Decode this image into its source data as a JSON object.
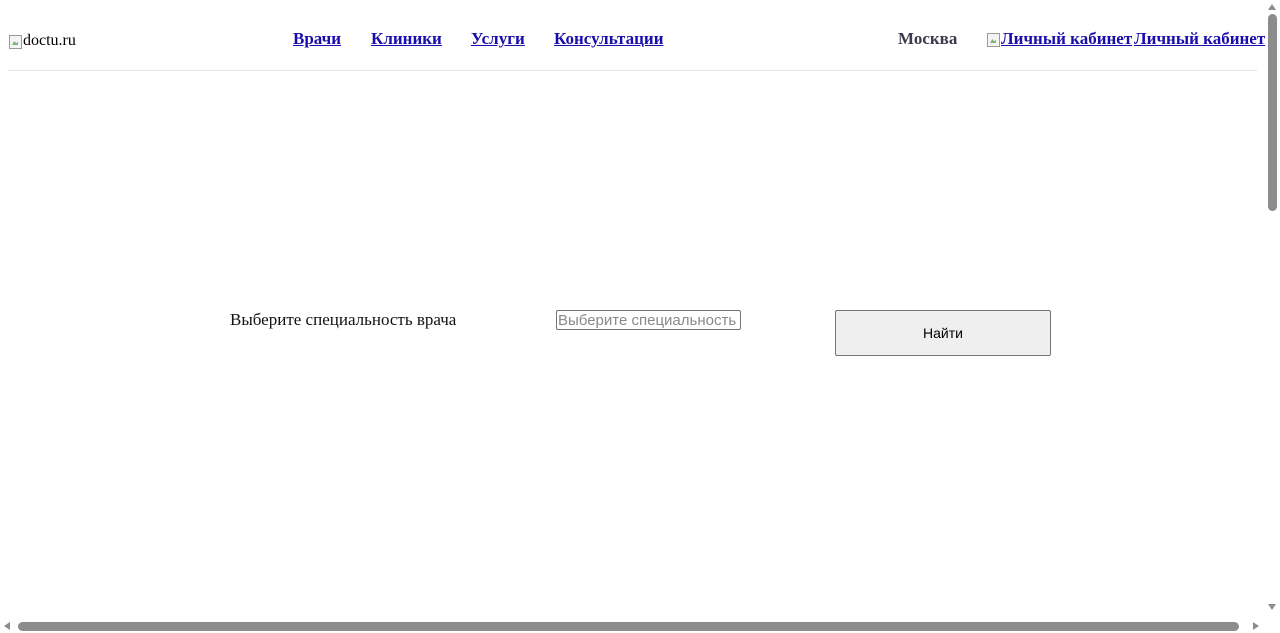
{
  "header": {
    "logo_alt": "doctu.ru",
    "nav": [
      {
        "label": "Врачи"
      },
      {
        "label": "Клиники"
      },
      {
        "label": "Услуги"
      },
      {
        "label": "Консультации"
      }
    ],
    "city": "Москва",
    "cabinet_image_alt": "Личный кабинет",
    "cabinet_link": "Личный кабинет"
  },
  "search": {
    "label": "Выберите специальность врача",
    "placeholder": "Выберите специальность врача",
    "button_label": "Найти"
  },
  "colors": {
    "link": "#1a0dab",
    "city": "#3b3b4f",
    "button_bg": "#efefef",
    "divider": "#e5e5e5"
  }
}
